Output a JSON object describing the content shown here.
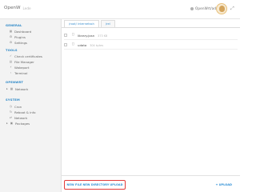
{
  "header": {
    "brand": "OpenW",
    "brand_sub": "Lede",
    "user": "OpenWrt/admin",
    "fullscreen_icon": "⤢"
  },
  "sidebar": {
    "sections": [
      {
        "title": "GENERAL",
        "items": [
          {
            "label": "Dashboard",
            "icon": "▦"
          },
          {
            "label": "Plugins",
            "icon": "⚙"
          },
          {
            "label": "Settings",
            "icon": "⚙"
          }
        ]
      },
      {
        "title": "TOOLS",
        "items": [
          {
            "label": "Check certificates",
            "icon": "✓"
          },
          {
            "label": "File Manager",
            "icon": "▤"
          },
          {
            "label": "Wakeport",
            "icon": "⚡"
          },
          {
            "label": "Terminal",
            "icon": "›"
          }
        ]
      },
      {
        "title": "OPENWRT",
        "items": [
          {
            "label": "Network",
            "icon": "▦",
            "expandable": true
          }
        ]
      },
      {
        "title": "SYSTEM",
        "items": [
          {
            "label": "Cron",
            "icon": "◷"
          },
          {
            "label": "Reboot & info",
            "icon": "↻"
          },
          {
            "label": "Network",
            "icon": "⇄"
          },
          {
            "label": "Packages",
            "icon": "▣",
            "expandable": true
          }
        ]
      }
    ]
  },
  "main": {
    "tabs": [
      "/root/ internetssh",
      "/rel"
    ],
    "files": [
      {
        "name": "library.josn",
        "size": "373 KB"
      },
      {
        "name": "udata",
        "size": "304 bytes"
      }
    ]
  },
  "bottom_bar": {
    "new_file": "NEW FILE",
    "new_directory": "NEW DIRECTORY",
    "upload": "UPLOAD",
    "upload_right": "UPLOAD",
    "upload_icon": "+"
  },
  "colors": {
    "accent": "#2f8fd5",
    "section_title": "#2b87c7",
    "highlight_box": "#e23b3b"
  }
}
